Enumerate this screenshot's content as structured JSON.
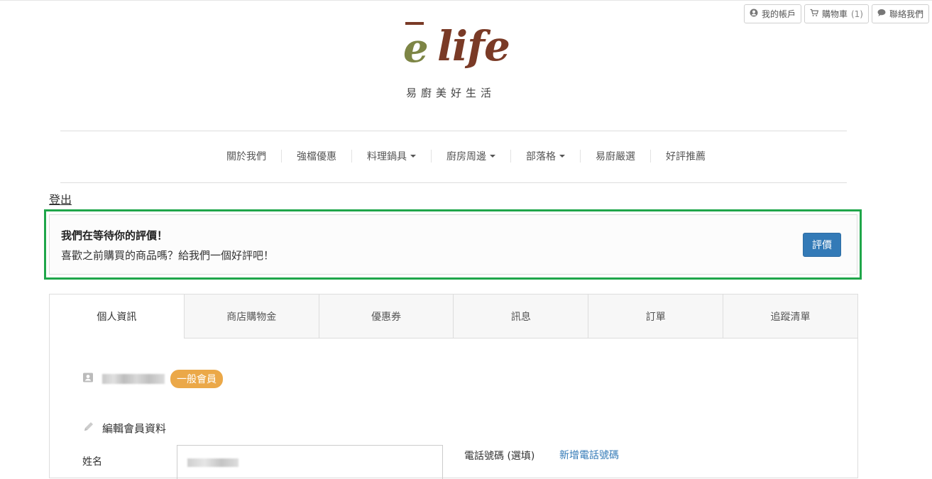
{
  "topbar": {
    "account": {
      "label": "我的帳戶",
      "icon": "user-circle-icon"
    },
    "cart": {
      "label": "購物車",
      "count": "1",
      "icon": "cart-icon"
    },
    "contact": {
      "label": "聯絡我們",
      "icon": "chat-bubble-icon"
    }
  },
  "logo": {
    "e": "e",
    "life": "life",
    "tagline": "易廚美好生活",
    "colors": {
      "green": "#7d8545",
      "brown": "#7a3a26"
    }
  },
  "nav": {
    "items": [
      {
        "label": "關於我們",
        "dropdown": false
      },
      {
        "label": "強檔優惠",
        "dropdown": false
      },
      {
        "label": "料理鍋具",
        "dropdown": true
      },
      {
        "label": "廚房周邊",
        "dropdown": true
      },
      {
        "label": "部落格",
        "dropdown": true
      },
      {
        "label": "易廚嚴選",
        "dropdown": false
      },
      {
        "label": "好評推薦",
        "dropdown": false
      }
    ]
  },
  "logout_label": "登出",
  "review": {
    "title": "我們在等待你的評價！",
    "subtitle": "喜歡之前購買的商品嗎？給我們一個好評吧！",
    "button_label": "評價",
    "highlight_color": "#1fa64a"
  },
  "tabs": [
    {
      "label": "個人資訊",
      "active": true
    },
    {
      "label": "商店購物金",
      "active": false
    },
    {
      "label": "優惠券",
      "active": false
    },
    {
      "label": "訊息",
      "active": false
    },
    {
      "label": "訂單",
      "active": false
    },
    {
      "label": "追蹤清單",
      "active": false
    }
  ],
  "profile": {
    "member_badge": "一般會員",
    "badge_color": "#eba848",
    "edit_title": "編輯會員資料",
    "name_label": "姓名",
    "phone_label": "電話號碼 (選填)",
    "add_phone_label": "新增電話號碼"
  }
}
